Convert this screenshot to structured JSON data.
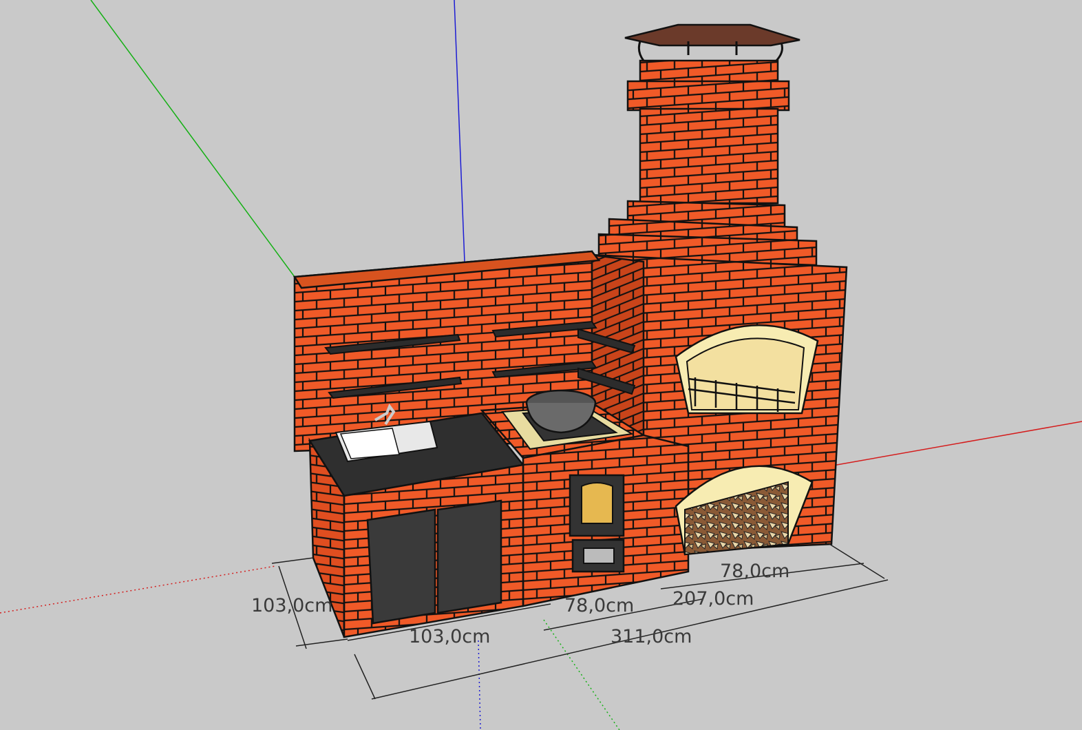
{
  "viewport": {
    "background": "#c9c9c9",
    "axes": {
      "red": "#d41c1c",
      "green": "#14b014",
      "blue": "#1c1cd4"
    }
  },
  "model": {
    "brick_color": "#f05a28",
    "brick_light": "#f7ecb2",
    "countertop_color": "#2f2f2f",
    "cap_color": "#6b3a2a",
    "objects": [
      "chimney-cap-icon",
      "sink-icon",
      "faucet-icon",
      "wok-icon",
      "shelf-icon",
      "oven-door-icon",
      "ash-door-icon",
      "grill-grate-icon",
      "firewood-icon",
      "cabinet-door-icon"
    ]
  },
  "dimensions": {
    "depth_left": "103,0cm",
    "front_left": "103,0cm",
    "front_middle": "78,0cm",
    "front_right": "78,0cm",
    "mid_total": "207,0cm",
    "total": "311,0cm"
  }
}
